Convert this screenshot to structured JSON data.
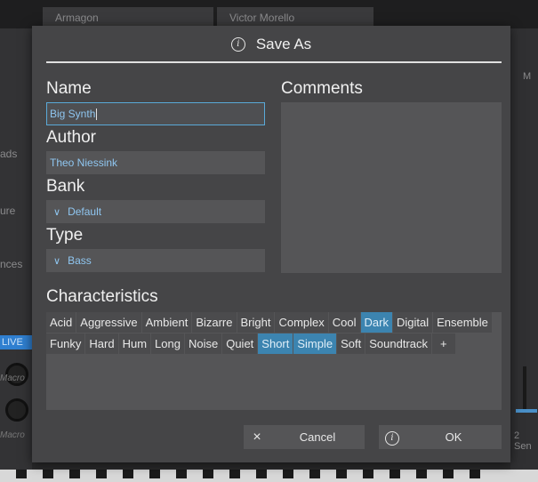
{
  "background": {
    "top_cells": [
      "Armagon",
      "Victor Morello"
    ],
    "left_labels": [
      "ads",
      "ure",
      "nces"
    ],
    "live_label": "LIVE",
    "macro_labels": [
      "Macro",
      "Macro"
    ],
    "right_labels": [
      "M",
      "2 Sen"
    ]
  },
  "dialog": {
    "title": "Save As",
    "name_label": "Name",
    "name_value": "Big Synth",
    "author_label": "Author",
    "author_value": "Theo Niessink",
    "bank_label": "Bank",
    "bank_value": "Default",
    "type_label": "Type",
    "type_value": "Bass",
    "comments_label": "Comments",
    "characteristics_label": "Characteristics",
    "tags": [
      {
        "label": "Acid",
        "selected": false
      },
      {
        "label": "Aggressive",
        "selected": false
      },
      {
        "label": "Ambient",
        "selected": false
      },
      {
        "label": "Bizarre",
        "selected": false
      },
      {
        "label": "Bright",
        "selected": false
      },
      {
        "label": "Complex",
        "selected": false
      },
      {
        "label": "Cool",
        "selected": false
      },
      {
        "label": "Dark",
        "selected": true
      },
      {
        "label": "Digital",
        "selected": false
      },
      {
        "label": "Ensemble",
        "selected": false
      },
      {
        "label": "Funky",
        "selected": false
      },
      {
        "label": "Hard",
        "selected": false
      },
      {
        "label": "Hum",
        "selected": false
      },
      {
        "label": "Long",
        "selected": false
      },
      {
        "label": "Noise",
        "selected": false
      },
      {
        "label": "Quiet",
        "selected": false
      },
      {
        "label": "Short",
        "selected": true
      },
      {
        "label": "Simple",
        "selected": true
      },
      {
        "label": "Soft",
        "selected": false
      },
      {
        "label": "Soundtrack",
        "selected": false
      }
    ],
    "add_tag_label": "+",
    "cancel_label": "Cancel",
    "cancel_icon": "×",
    "ok_label": "OK",
    "info_glyph": "i"
  },
  "colors": {
    "accent": "#3c84b0",
    "field_text": "#8fc6f0",
    "dialog_bg": "#454547",
    "field_bg": "#555557"
  }
}
